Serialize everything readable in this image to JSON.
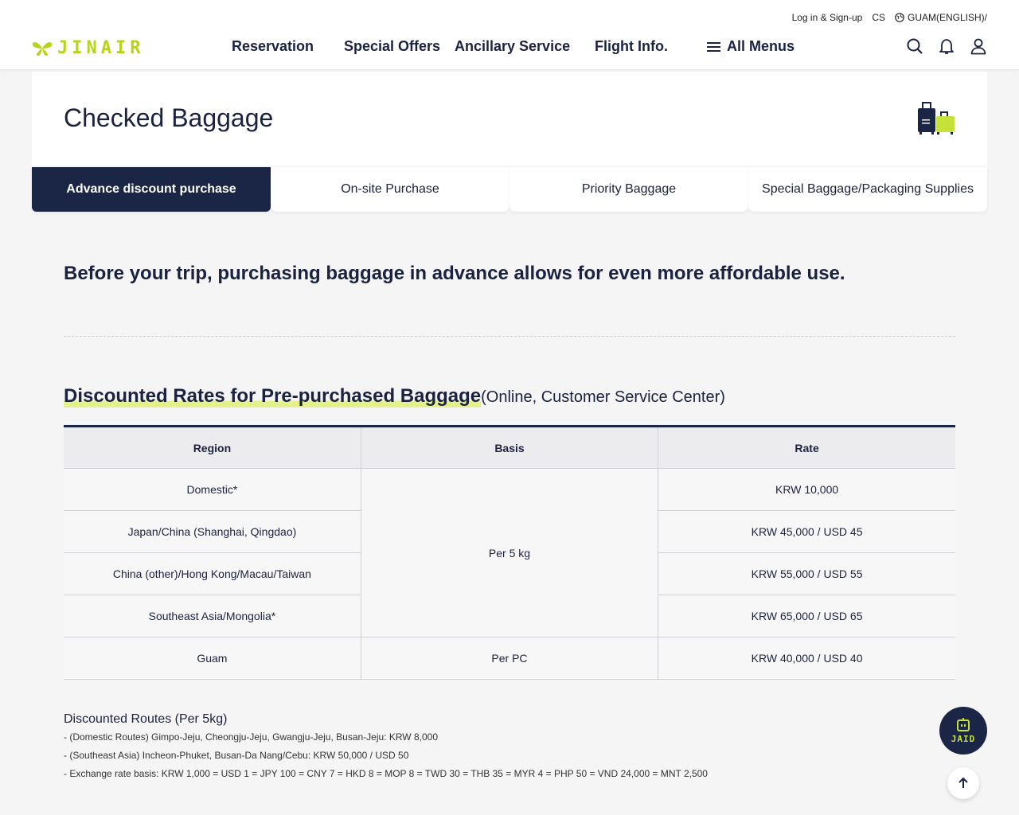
{
  "header": {
    "util": {
      "login": "Log in & Sign-up",
      "cs": "CS",
      "lang": "GUAM(ENGLISH)/"
    },
    "logo_text": "JINAIR",
    "nav": [
      "Reservation",
      "Special Offers",
      "Ancillary Service",
      "Flight Info.",
      "All Menus"
    ],
    "icons": [
      "search-icon",
      "bell-icon",
      "user-icon"
    ]
  },
  "page": {
    "title": "Checked Baggage"
  },
  "tabs": [
    "Advance discount purchase",
    "On-site Purchase",
    "Priority Baggage",
    "Special Baggage/Packaging Supplies"
  ],
  "active_tab": 0,
  "lead": "Before your trip, purchasing baggage in advance allows for even more affordable use.",
  "section": {
    "title": "Discounted Rates for Pre-purchased Baggage",
    "subtitle": "(Online, Customer Service Center)"
  },
  "table": {
    "headers": [
      "Region",
      "Basis",
      "Rate"
    ],
    "rows": [
      {
        "region": "Domestic*",
        "rate": "KRW 10,000"
      },
      {
        "region": "Japan/China (Shanghai, Qingdao)",
        "rate": "KRW 45,000 / USD 45"
      },
      {
        "region": "China (other)/Hong Kong/Macau/Taiwan",
        "rate": "KRW 55,000 / USD 55"
      },
      {
        "region": "Southeast Asia/Mongolia*",
        "rate": "KRW 65,000 / USD 65"
      },
      {
        "region": "Guam",
        "basis": "Per PC",
        "rate": "KRW 40,000 / USD 40"
      }
    ],
    "basis_merged": "Per 5 kg"
  },
  "notes": {
    "title": "Discounted Routes (Per 5kg)",
    "items": [
      "(Domestic Routes) Gimpo-Jeju, Cheongju-Jeju, Gwangju-Jeju, Busan-Jeju: KRW 8,000",
      "(Southeast Asia) Incheon-Phuket, Busan-Da Nang/Cebu: KRW 50,000 / USD 50",
      "Exchange rate basis: KRW 1,000 = USD 1 = JPY 100 = CNY 7 = HKD 8 = MOP 8 = TWD 30 = THB 35 = MYR 4 = PHP 50 = VND 24,000 = MNT 2,500"
    ]
  },
  "floating": {
    "jaid_label": "JAID"
  },
  "colors": {
    "navy": "#1b2546",
    "lime": "#b7d31a"
  }
}
